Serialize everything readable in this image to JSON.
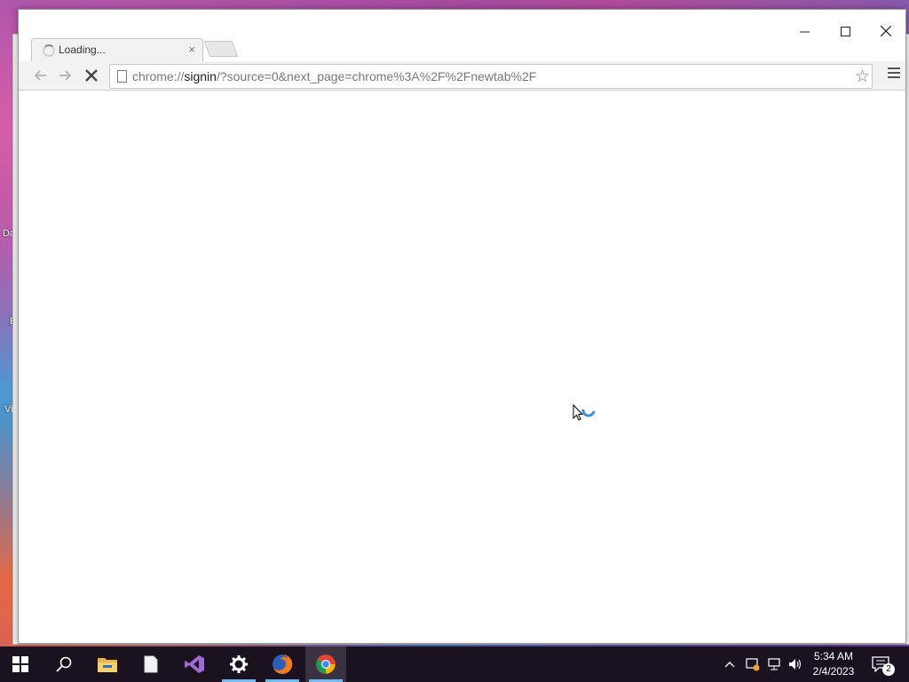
{
  "desktop": {
    "labels": [
      "Da",
      "E",
      "Vi"
    ]
  },
  "window": {
    "controls": {
      "minimize": "—",
      "maximize": "☐",
      "close": "✕"
    },
    "tab": {
      "title": "Loading...",
      "close": "×"
    }
  },
  "toolbar": {
    "back_icon": "arrow-left-icon",
    "forward_icon": "arrow-right-icon",
    "stop_icon": "stop-x-icon",
    "url": {
      "scheme": "chrome://",
      "host": "signin",
      "rest": "/?source=0&next_page=chrome%3A%2F%2Fnewtab%2F"
    },
    "star_glyph": "☆"
  },
  "taskbar": {
    "items": [
      {
        "name": "start",
        "icon": "windows-logo-icon"
      },
      {
        "name": "search",
        "icon": "search-icon"
      },
      {
        "name": "file-explorer",
        "icon": "folder-icon"
      },
      {
        "name": "document",
        "icon": "document-icon"
      },
      {
        "name": "visual-studio",
        "icon": "visual-studio-icon"
      },
      {
        "name": "settings",
        "icon": "gear-icon",
        "running": true
      },
      {
        "name": "firefox",
        "icon": "firefox-icon",
        "running": true
      },
      {
        "name": "chrome",
        "icon": "chrome-icon",
        "running": true,
        "active": true
      }
    ],
    "clock": {
      "time": "5:34 AM",
      "date": "2/4/2023"
    },
    "notifications_count": "2"
  },
  "colors": {
    "taskbar_bg": "#1b1220",
    "running_indicator": "#76b9ed",
    "accent_blue": "#3a8fd8"
  }
}
